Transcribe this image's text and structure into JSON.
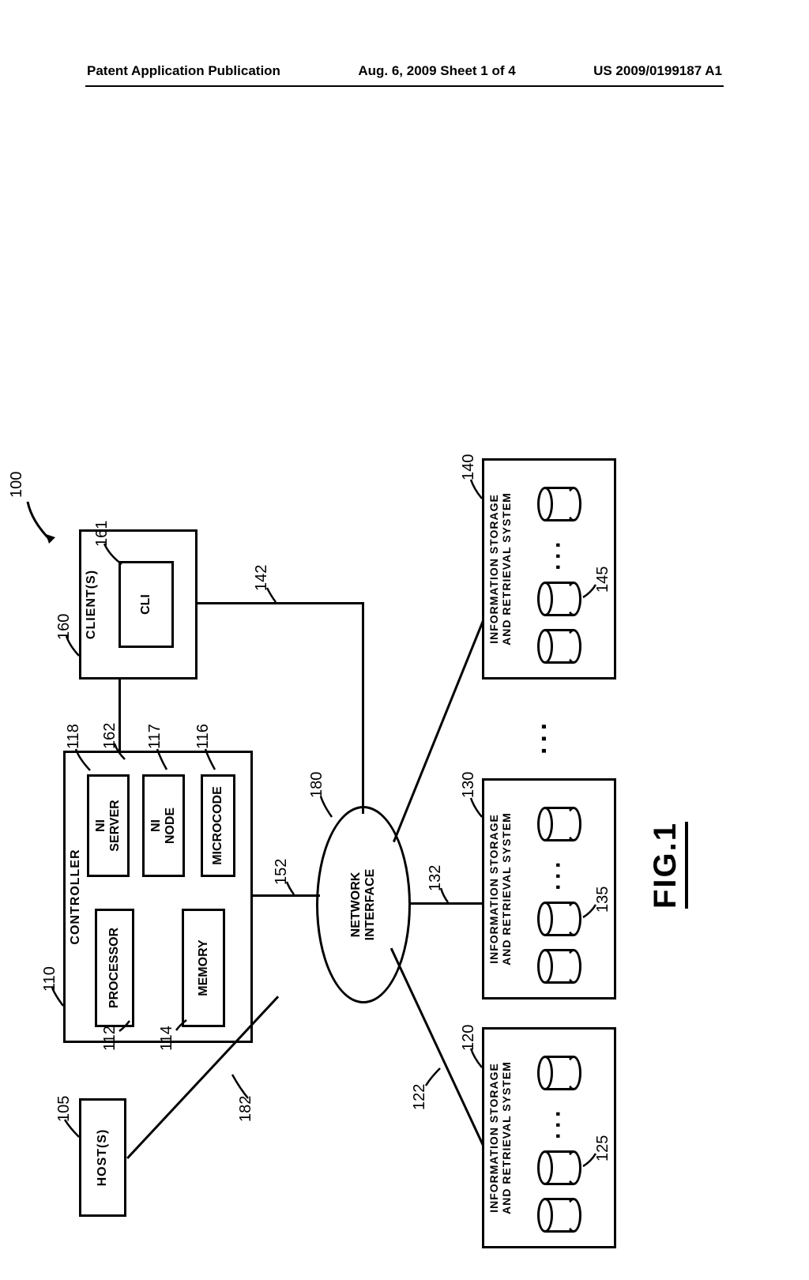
{
  "header": {
    "left": "Patent Application Publication",
    "center": "Aug. 6, 2009  Sheet 1 of 4",
    "right": "US 2009/0199187 A1"
  },
  "figure_label": "FIG.1",
  "refs": {
    "r100": "100",
    "r105": "105",
    "r110": "110",
    "r112": "112",
    "r114": "114",
    "r116": "116",
    "r117": "117",
    "r118": "118",
    "r120": "120",
    "r122": "122",
    "r125": "125",
    "r130": "130",
    "r132": "132",
    "r135": "135",
    "r140": "140",
    "r142": "142",
    "r145": "145",
    "r152": "152",
    "r160": "160",
    "r161": "161",
    "r162": "162",
    "r180": "180",
    "r182": "182"
  },
  "labels": {
    "hosts": "HOST(S)",
    "controller": "CONTROLLER",
    "processor": "PROCESSOR",
    "memory": "MEMORY",
    "ni_server": "NI\nSERVER",
    "ni_node": "NI\nNODE",
    "microcode": "MICROCODE",
    "clients": "CLIENT(S)",
    "cli": "CLI",
    "network_interface": "NETWORK\nINTERFACE",
    "storage": "INFORMATION STORAGE\nAND RETRIEVAL SYSTEM"
  }
}
